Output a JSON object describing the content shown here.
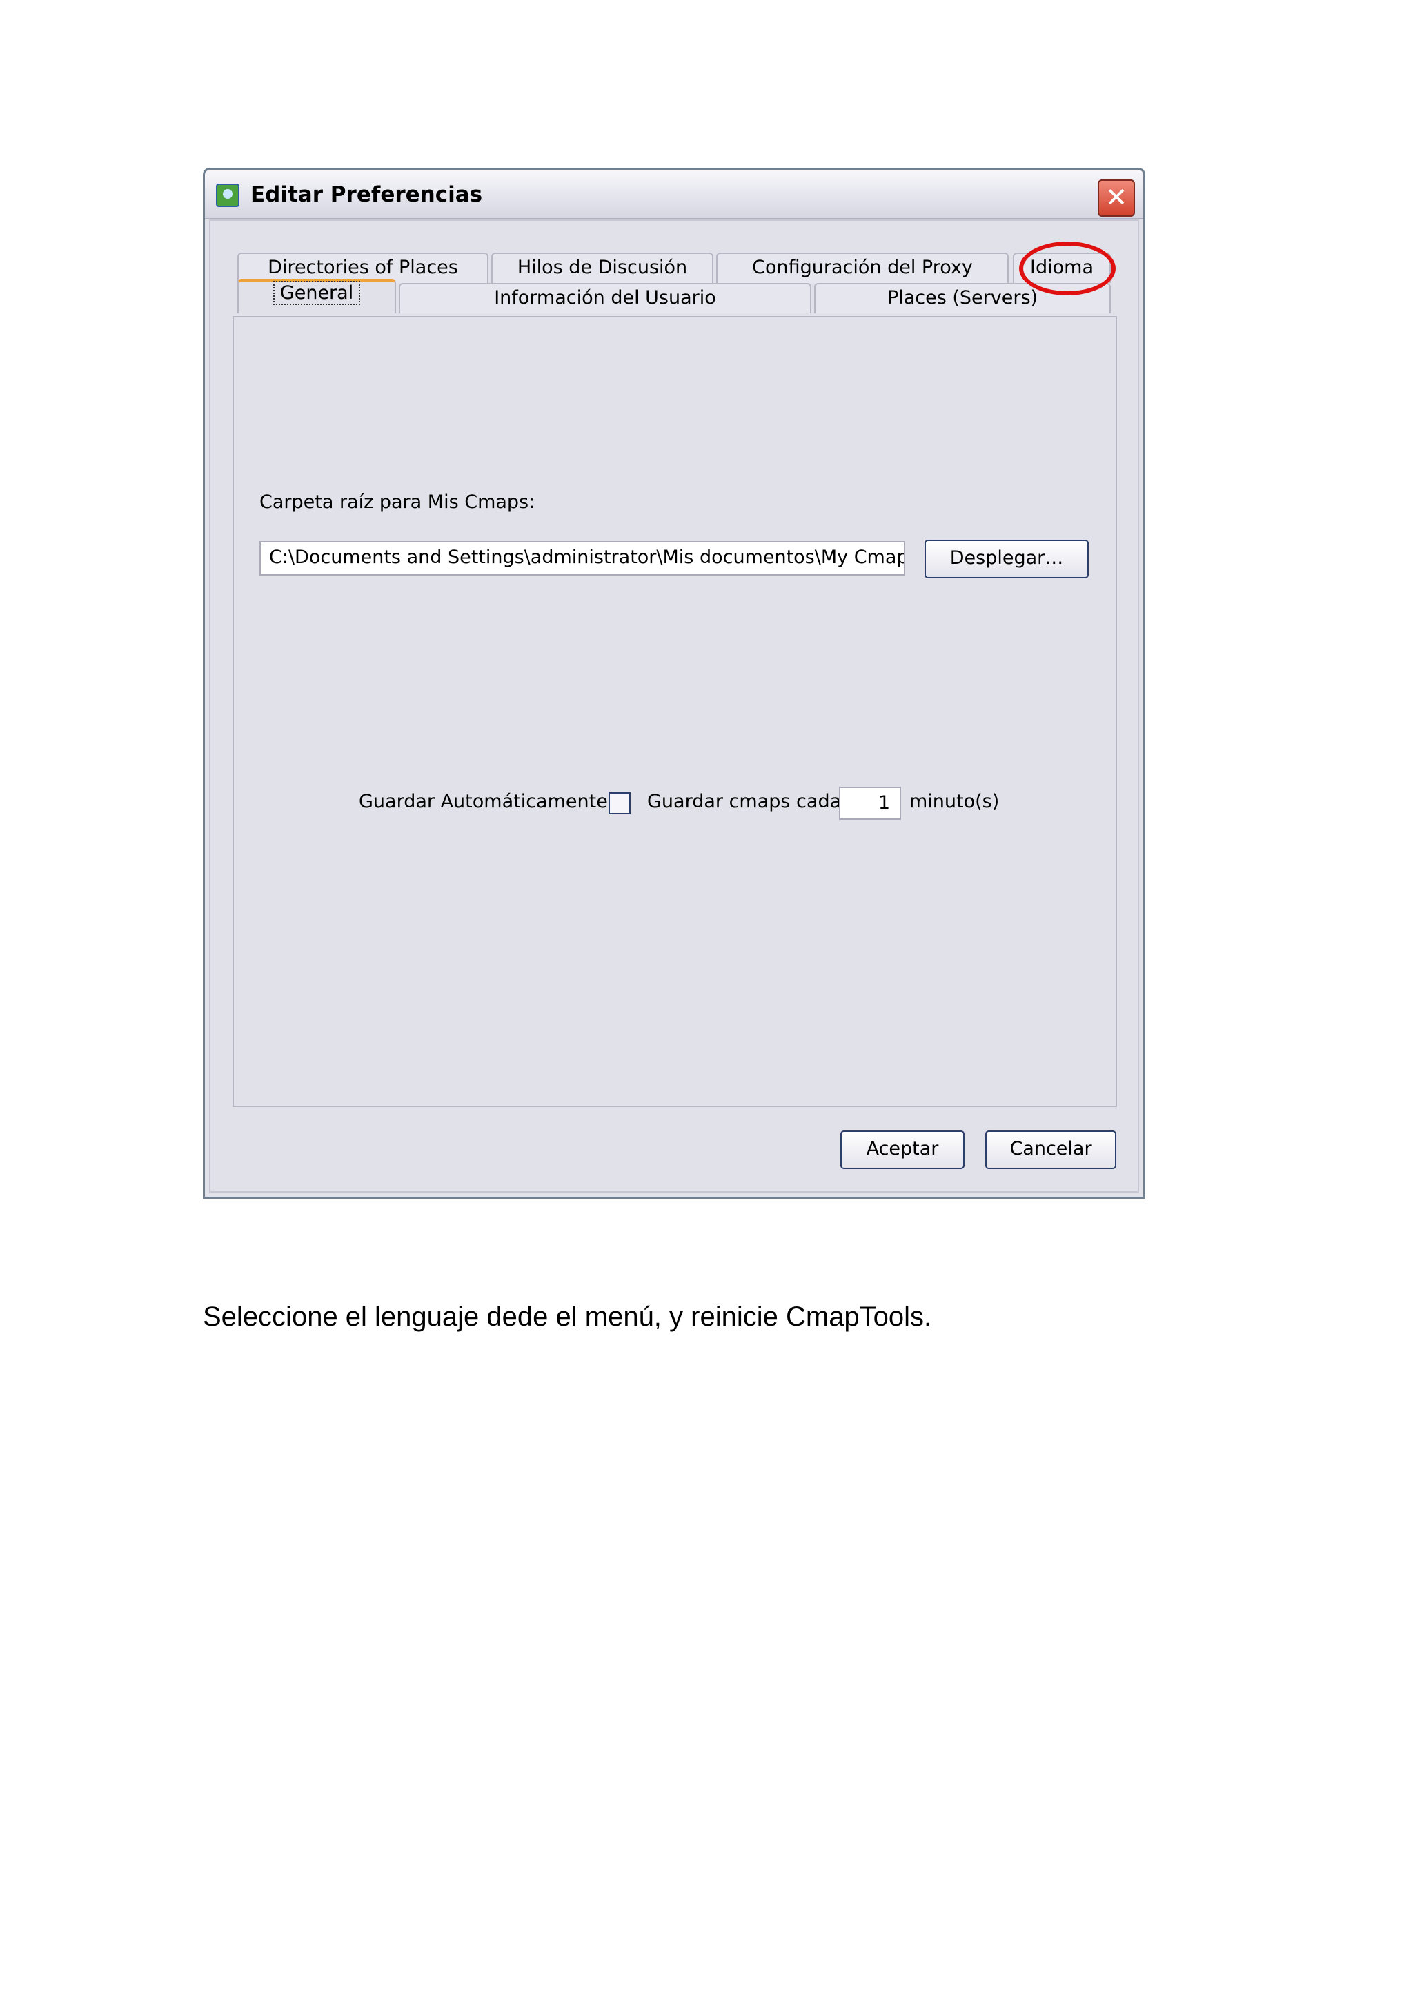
{
  "window": {
    "title": "Editar Preferencias",
    "close_symbol": "✕"
  },
  "tabs": {
    "row_top": [
      {
        "label": "Directories of Places"
      },
      {
        "label": "Hilos de Discusión"
      },
      {
        "label": "Configuración del Proxy"
      },
      {
        "label": "Idioma"
      }
    ],
    "row_bottom": [
      {
        "label": "General",
        "active": true
      },
      {
        "label": "Información del Usuario"
      },
      {
        "label": "Places (Servers)"
      }
    ]
  },
  "general": {
    "root_folder_label": "Carpeta raíz para Mis Cmaps:",
    "root_folder_value": "C:\\Documents and Settings\\administrator\\Mis documentos\\My Cmaps",
    "browse_button": "Desplegar…",
    "autosave_label": "Guardar Automáticamente:",
    "autosave_checked": false,
    "autosave_every_label": "Guardar cmaps cada",
    "autosave_minutes": "1",
    "minutes_unit": "minuto(s)"
  },
  "footer": {
    "ok_button": "Aceptar",
    "cancel_button": "Cancelar"
  },
  "annotation": {
    "highlight_color": "#e01010",
    "highlighted_tab": "Idioma"
  },
  "caption": "Seleccione el lenguaje dede el menú, y reinicie CmapTools."
}
